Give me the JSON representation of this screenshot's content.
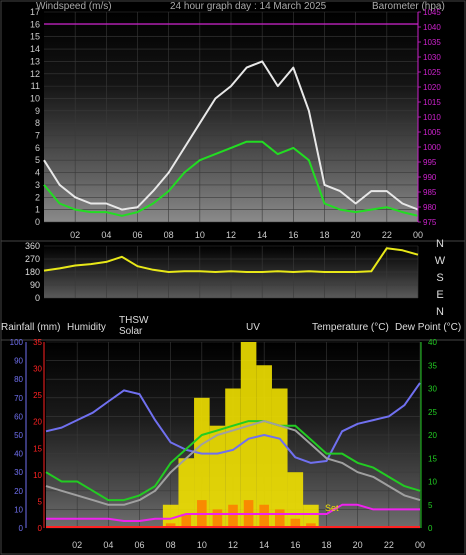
{
  "header": {
    "left_label": "Windspeed (m/s)",
    "title": "24 hour graph day : 14 March 2025",
    "right_label": "Barometer (hpa)"
  },
  "mid_labels": {
    "rainfall": "Rainfall (mm)",
    "humidity": "Humidity",
    "thsw": "THSW",
    "solar": "Solar",
    "uv": "UV",
    "temperature": "Temperature (°C)",
    "dewpoint": "Dew Point (°C)"
  },
  "colors": {
    "wind_gust": "#e8e8e8",
    "wind_avg": "#22dd22",
    "barometer": "#cc22cc",
    "direction": "#e8e818",
    "temperature": "#22cc22",
    "thsw": "#a0a0a0",
    "humidity": "#7070f0",
    "solar": "#f0e000",
    "uv": "#ff7700",
    "dewpoint": "#ee22ee",
    "rain": "#ff2222"
  },
  "chart_data": [
    {
      "type": "line",
      "name": "wind",
      "x_ticks": [
        "02",
        "04",
        "06",
        "08",
        "10",
        "12",
        "14",
        "16",
        "18",
        "20",
        "22",
        "00"
      ],
      "left_axis": {
        "label": "Windspeed (m/s)",
        "ylim": [
          0,
          17
        ],
        "ticks": [
          "0",
          "1",
          "2",
          "3",
          "4",
          "5",
          "6",
          "7",
          "8",
          "9",
          "10",
          "11",
          "12",
          "13",
          "14",
          "15",
          "16",
          "17"
        ]
      },
      "right_axis": {
        "label": "Barometer (hpa)",
        "ylim": [
          975,
          1045
        ],
        "ticks": [
          "975",
          "980",
          "985",
          "990",
          "995",
          "1000",
          "1005",
          "1010",
          "1015",
          "1020",
          "1025",
          "1030",
          "1035",
          "1040",
          "1045"
        ]
      },
      "x_hours": [
        0,
        1,
        2,
        3,
        4,
        5,
        6,
        7,
        8,
        9,
        10,
        11,
        12,
        13,
        14,
        15,
        16,
        17,
        18,
        19,
        20,
        21,
        22,
        23,
        24
      ],
      "series": [
        {
          "name": "gust",
          "values": [
            5,
            3,
            2,
            1.5,
            1.5,
            1,
            1.2,
            2.5,
            4,
            6,
            8,
            10,
            11,
            12.5,
            13,
            11,
            12.5,
            9,
            3,
            2.5,
            1.5,
            2.5,
            2.5,
            1.5,
            1
          ]
        },
        {
          "name": "average",
          "values": [
            3,
            1.5,
            1,
            0.8,
            0.8,
            0.5,
            0.8,
            1.5,
            2.5,
            4,
            5,
            5.5,
            6,
            6.5,
            6.5,
            5.5,
            6,
            5,
            1.5,
            1,
            0.8,
            1,
            1.2,
            0.8,
            0.5
          ]
        },
        {
          "name": "barometer",
          "values": [
            1041,
            1041,
            1041,
            1041,
            1041,
            1041,
            1041,
            1041,
            1041,
            1041,
            1041,
            1041,
            1041,
            1041,
            1041,
            1041,
            1041,
            1041,
            1041,
            1041,
            1041,
            1041,
            1041,
            1041,
            1041
          ]
        }
      ]
    },
    {
      "type": "line",
      "name": "wind-direction",
      "left_axis": {
        "ylim": [
          0,
          360
        ],
        "ticks": [
          "0",
          "90",
          "180",
          "270",
          "360"
        ]
      },
      "right_labels": [
        "N",
        "W",
        "S",
        "E",
        "N"
      ],
      "x_hours": [
        0,
        1,
        2,
        3,
        4,
        5,
        6,
        7,
        8,
        9,
        10,
        11,
        12,
        13,
        14,
        15,
        16,
        17,
        18,
        19,
        20,
        21,
        22,
        23,
        24
      ],
      "series": [
        {
          "name": "direction",
          "values": [
            190,
            205,
            225,
            235,
            250,
            285,
            220,
            195,
            180,
            185,
            185,
            180,
            185,
            180,
            180,
            185,
            180,
            185,
            180,
            180,
            180,
            185,
            345,
            330,
            300
          ]
        }
      ]
    },
    {
      "type": "line",
      "name": "temperature-humidity",
      "axes": {
        "humidity": {
          "ylim": [
            0,
            100
          ],
          "ticks": [
            "0",
            "10",
            "20",
            "30",
            "40",
            "50",
            "60",
            "70",
            "80",
            "90",
            "100"
          ]
        },
        "rainfall": {
          "ylim": [
            0,
            35
          ],
          "ticks": [
            "0",
            "5",
            "10",
            "15",
            "20",
            "25",
            "30",
            "35"
          ]
        },
        "temperature": {
          "ylim": [
            0,
            40
          ],
          "ticks": [
            "0",
            "5",
            "10",
            "15",
            "20",
            "25",
            "30",
            "35",
            "40"
          ]
        }
      },
      "x_hours": [
        0,
        1,
        2,
        3,
        4,
        5,
        6,
        7,
        8,
        9,
        10,
        11,
        12,
        13,
        14,
        15,
        16,
        17,
        18,
        19,
        20,
        21,
        22,
        23,
        24
      ],
      "series": [
        {
          "name": "humidity",
          "values": [
            52,
            54,
            58,
            62,
            68,
            74,
            72,
            58,
            46,
            42,
            40,
            40,
            42,
            48,
            50,
            48,
            38,
            35,
            36,
            52,
            56,
            58,
            60,
            66,
            78
          ]
        },
        {
          "name": "temperature",
          "values": [
            12,
            10,
            10,
            8,
            6,
            6,
            7,
            9,
            14,
            17,
            20,
            21,
            22,
            23,
            23,
            22,
            22,
            19,
            16,
            16,
            14,
            13,
            11,
            9,
            8
          ]
        },
        {
          "name": "thsw",
          "values": [
            9,
            8,
            7,
            6,
            5,
            5,
            6,
            8,
            12,
            15,
            18,
            20,
            21,
            22,
            23,
            22,
            21,
            18,
            15,
            14,
            12,
            11,
            9,
            7,
            6
          ]
        },
        {
          "name": "dewpoint",
          "values": [
            2,
            2,
            2,
            2,
            2,
            1.5,
            1.5,
            2,
            2,
            3,
            3,
            3,
            3,
            3,
            3,
            3,
            3,
            3,
            3,
            5,
            5,
            4,
            4,
            4,
            4
          ]
        },
        {
          "name": "solar",
          "values": [
            0,
            0,
            0,
            0,
            0,
            0,
            0,
            0,
            5,
            15,
            28,
            22,
            30,
            40,
            35,
            30,
            12,
            5,
            0,
            0,
            0,
            0,
            0,
            0,
            0
          ]
        },
        {
          "name": "uv",
          "values": [
            0,
            0,
            0,
            0,
            0,
            0,
            0,
            0,
            1,
            3,
            6,
            4,
            5,
            6,
            5,
            4,
            2,
            1,
            0,
            0,
            0,
            0,
            0,
            0,
            0
          ]
        }
      ],
      "annotations": [
        "Set"
      ]
    }
  ]
}
